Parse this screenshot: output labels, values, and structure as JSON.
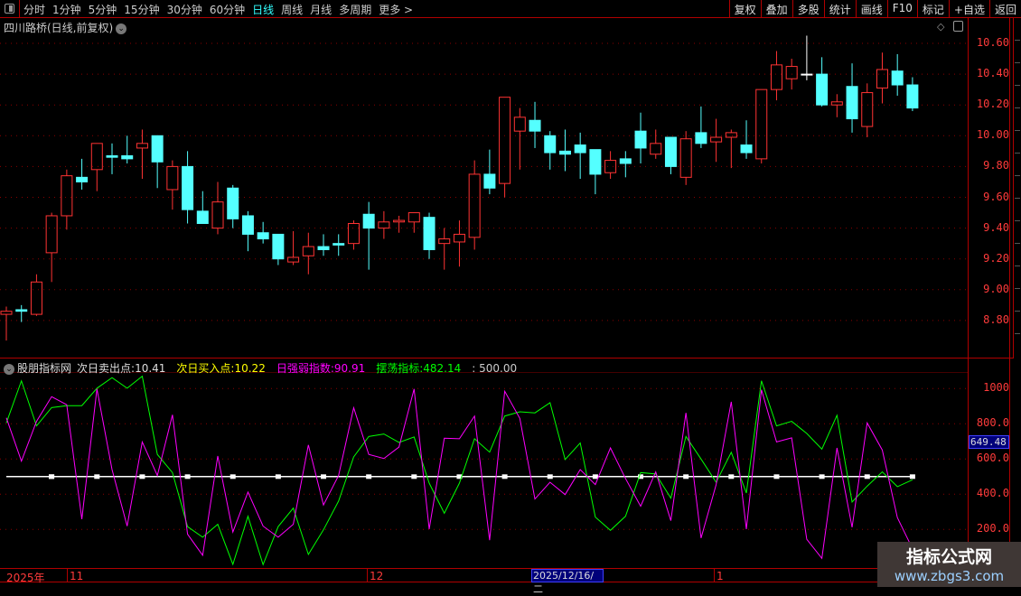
{
  "toolbar": {
    "periods": [
      "分时",
      "1分钟",
      "5分钟",
      "15分钟",
      "30分钟",
      "60分钟",
      "日线",
      "周线",
      "月线",
      "多周期",
      "更多 >"
    ],
    "active_period": "日线",
    "tools": [
      "复权",
      "叠加",
      "多股",
      "统计",
      "画线",
      "F10",
      "标记",
      "+自选",
      "返回"
    ]
  },
  "chart": {
    "title": "四川路桥(日线,前复权)",
    "price_axis": [
      "10.60",
      "10.40",
      "10.20",
      "10.00",
      "9.80",
      "9.60",
      "9.40",
      "9.20",
      "9.00",
      "8.80"
    ],
    "colors": {
      "up": "#ff3333",
      "down": "#54ffff",
      "flat": "#ffffff"
    },
    "candles": [
      [
        8.84,
        8.89,
        8.67,
        8.86
      ],
      [
        8.87,
        8.9,
        8.79,
        8.86
      ],
      [
        8.84,
        9.1,
        8.83,
        9.05
      ],
      [
        9.24,
        9.5,
        9.05,
        9.48
      ],
      [
        9.48,
        9.78,
        9.39,
        9.74
      ],
      [
        9.73,
        9.85,
        9.65,
        9.7
      ],
      [
        9.78,
        9.95,
        9.64,
        9.95
      ],
      [
        9.87,
        9.95,
        9.75,
        9.86
      ],
      [
        9.87,
        10.0,
        9.82,
        9.85
      ],
      [
        9.92,
        10.04,
        9.72,
        9.95
      ],
      [
        10.0,
        10.0,
        9.66,
        9.83
      ],
      [
        9.65,
        9.84,
        9.52,
        9.8
      ],
      [
        9.8,
        9.9,
        9.43,
        9.52
      ],
      [
        9.51,
        9.64,
        9.43,
        9.43
      ],
      [
        9.4,
        9.7,
        9.36,
        9.57
      ],
      [
        9.66,
        9.68,
        9.4,
        9.46
      ],
      [
        9.48,
        9.51,
        9.25,
        9.36
      ],
      [
        9.37,
        9.44,
        9.3,
        9.33
      ],
      [
        9.36,
        9.36,
        9.16,
        9.2
      ],
      [
        9.18,
        9.38,
        9.16,
        9.21
      ],
      [
        9.22,
        9.37,
        9.1,
        9.28
      ],
      [
        9.28,
        9.36,
        9.22,
        9.26
      ],
      [
        9.3,
        9.36,
        9.22,
        9.29
      ],
      [
        9.3,
        9.45,
        9.26,
        9.43
      ],
      [
        9.49,
        9.57,
        9.13,
        9.4
      ],
      [
        9.4,
        9.51,
        9.33,
        9.44
      ],
      [
        9.44,
        9.48,
        9.37,
        9.45
      ],
      [
        9.44,
        9.5,
        9.37,
        9.5
      ],
      [
        9.47,
        9.5,
        9.2,
        9.26
      ],
      [
        9.3,
        9.4,
        9.13,
        9.33
      ],
      [
        9.31,
        9.45,
        9.15,
        9.36
      ],
      [
        9.34,
        9.84,
        9.26,
        9.75
      ],
      [
        9.75,
        9.91,
        9.62,
        9.66
      ],
      [
        9.69,
        10.25,
        9.6,
        10.25
      ],
      [
        10.03,
        10.18,
        9.78,
        10.12
      ],
      [
        10.1,
        10.22,
        9.92,
        10.03
      ],
      [
        10.0,
        10.03,
        9.78,
        9.89
      ],
      [
        9.9,
        10.04,
        9.77,
        9.88
      ],
      [
        9.94,
        10.02,
        9.72,
        9.89
      ],
      [
        9.91,
        9.91,
        9.62,
        9.75
      ],
      [
        9.76,
        9.9,
        9.72,
        9.84
      ],
      [
        9.85,
        9.9,
        9.73,
        9.82
      ],
      [
        10.03,
        10.15,
        9.82,
        9.92
      ],
      [
        9.88,
        10.04,
        9.85,
        9.95
      ],
      [
        9.99,
        9.99,
        9.75,
        9.8
      ],
      [
        9.73,
        10.03,
        9.68,
        9.98
      ],
      [
        10.02,
        10.19,
        9.92,
        9.95
      ],
      [
        9.96,
        10.11,
        9.83,
        9.99
      ],
      [
        9.99,
        10.04,
        9.79,
        10.02
      ],
      [
        9.94,
        10.1,
        9.85,
        9.89
      ],
      [
        9.85,
        10.3,
        9.82,
        10.3
      ],
      [
        10.3,
        10.55,
        10.23,
        10.46
      ],
      [
        10.37,
        10.5,
        10.3,
        10.45
      ],
      [
        10.4,
        10.65,
        10.36,
        10.4
      ],
      [
        10.4,
        10.51,
        10.19,
        10.2
      ],
      [
        10.2,
        10.27,
        10.12,
        10.22
      ],
      [
        10.32,
        10.47,
        10.02,
        10.11
      ],
      [
        10.06,
        10.34,
        9.99,
        10.28
      ],
      [
        10.31,
        10.54,
        10.21,
        10.43
      ],
      [
        10.42,
        10.53,
        10.26,
        10.33
      ],
      [
        10.33,
        10.38,
        10.16,
        10.18
      ]
    ]
  },
  "indicator": {
    "name": "股朋指标网",
    "sell_label": "次日卖出点:",
    "sell_value": "10.41",
    "buy_label": "次日买入点:",
    "buy_value": "10.22",
    "strength_label": "日强弱指数:",
    "strength_value": "90.91",
    "swing_label": "摆荡指标:",
    "swing_value": "482.14",
    "ref_value": ": 500.00",
    "axis": [
      "1000",
      "800.0",
      "600.0",
      "400.0",
      "200.0"
    ],
    "crosshair_value": "649.48",
    "colors": {
      "strength": "#ff00ff",
      "swing": "#00ff00",
      "ref": "#ffffff",
      "sell": "#dddddd",
      "buy": "#ffff00"
    },
    "reference_level": 500,
    "swing_series": [
      805,
      1044,
      788,
      892,
      903,
      903,
      1002,
      1062,
      1002,
      1070,
      626,
      523,
      216,
      156,
      229,
      2,
      275,
      0,
      216,
      321,
      58,
      198,
      361,
      612,
      728,
      742,
      694,
      725,
      463,
      292,
      463,
      715,
      639,
      844,
      868,
      862,
      920,
      597,
      691,
      270,
      195,
      275,
      523,
      515,
      378,
      728,
      600,
      468,
      638,
      407,
      1044,
      788,
      814,
      745,
      656,
      848,
      356,
      446,
      527,
      443,
      482
    ],
    "strength_series": [
      834,
      588,
      814,
      954,
      908,
      258,
      998,
      540,
      219,
      697,
      506,
      851,
      173,
      53,
      617,
      185,
      412,
      219,
      156,
      229,
      680,
      339,
      506,
      891,
      626,
      603,
      668,
      998,
      202,
      718,
      715,
      844,
      139,
      985,
      831,
      373,
      468,
      398,
      540,
      455,
      663,
      489,
      332,
      527,
      250,
      862,
      151,
      455,
      925,
      202,
      993,
      697,
      720,
      144,
      36,
      663,
      212,
      805,
      651,
      267,
      91
    ]
  },
  "time_axis": {
    "year": "2025年",
    "months": [
      "11",
      "12",
      "1"
    ],
    "selected_date": "2025/12/16/二"
  },
  "watermark": {
    "title": "指标公式网",
    "url": "www.zbgs3.com"
  }
}
